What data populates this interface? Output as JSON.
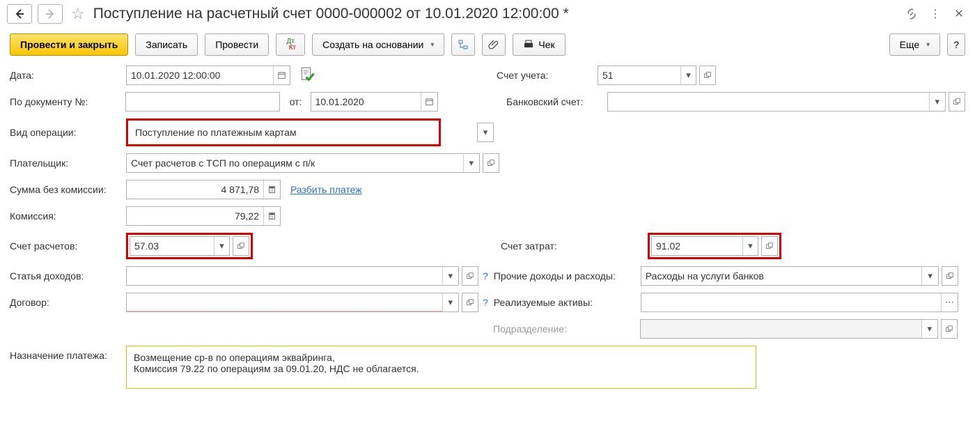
{
  "window": {
    "title": "Поступление на расчетный счет 0000-000002 от 10.01.2020 12:00:00 *"
  },
  "toolbar": {
    "post_close": "Провести и закрыть",
    "write": "Записать",
    "post": "Провести",
    "create_based": "Создать на основании",
    "more": "Еще",
    "help": "?",
    "check": "Чек"
  },
  "left": {
    "date_label": "Дата:",
    "date_value": "10.01.2020 12:00:00",
    "docnum_label": "По документу №:",
    "docnum_value": "",
    "docdate_label": "от:",
    "docdate_value": "10.01.2020",
    "optype_label": "Вид операции:",
    "optype_value": "Поступление по платежным картам",
    "payer_label": "Плательщик:",
    "payer_value": "Счет расчетов с ТСП по операциям с п/к",
    "sum_label": "Сумма без комиссии:",
    "sum_value": "4 871,78",
    "split_link": "Разбить платеж",
    "commission_label": "Комиссия:",
    "commission_value": "79,22",
    "acct_settle_label": "Счет расчетов:",
    "acct_settle_value": "57.03",
    "income_label": "Статья доходов:",
    "income_value": "",
    "contract_label": "Договор:",
    "contract_value": "",
    "purpose_label": "Назначение платежа:",
    "purpose_line1": "Возмещение ср-в по операциям эквайринга,",
    "purpose_line2": "Комиссия 79.22 по операциям за 09.01.20, НДС не облагается."
  },
  "right": {
    "acct_label": "Счет учета:",
    "acct_value": "51",
    "bankacct_label": "Банковский счет:",
    "bankacct_value": "",
    "cost_acct_label": "Счет затрат:",
    "cost_acct_value": "91.02",
    "other_label": "Прочие доходы и расходы:",
    "other_value": "Расходы на услуги банков",
    "assets_label": "Реализуемые активы:",
    "assets_value": "",
    "dept_label": "Подразделение:",
    "dept_value": ""
  }
}
